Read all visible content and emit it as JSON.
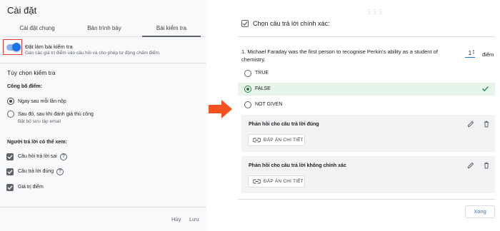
{
  "settings": {
    "title": "Cài đặt",
    "tabs": [
      "Cài đặt chung",
      "Bản trình bày",
      "Bài kiểm tra"
    ],
    "active_tab": "Bài kiểm tra",
    "quiz_toggle": {
      "label": "Đặt làm bài kiểm tra",
      "description": "Gán các giá trị điểm vào câu hỏi và cho phép tự động chấm điểm.",
      "on": true
    },
    "quiz_options_title": "Tùy chọn kiểm tra",
    "release_grade": {
      "title": "Công bố điểm:",
      "options": [
        {
          "label": "Ngay sau mỗi lần nộp",
          "checked": true
        },
        {
          "label": "Sau đó, sau khi đánh giá thủ công",
          "sub": "Bật bộ sưu tập email",
          "checked": false
        }
      ]
    },
    "respondent_can_see": {
      "title": "Người trả lời có thể xem:",
      "items": [
        {
          "label": "Câu hỏi trả lời sai",
          "checked": true
        },
        {
          "label": "Câu trả lời đúng",
          "checked": true
        },
        {
          "label": "Giá trị điểm",
          "checked": true
        }
      ]
    },
    "cancel_label": "Hủy",
    "save_label": "Lưu"
  },
  "answer_key": {
    "header": "Chọn câu trả lời chính xác:",
    "question": "1. Michael Faraday was the first person to recognise Perkin's ability as a student of chemistry.",
    "points_value": "1",
    "points_label": "điểm",
    "answers": [
      {
        "label": "TRUE",
        "correct": false
      },
      {
        "label": "FALSE",
        "correct": true
      },
      {
        "label": "NOT GIVEN",
        "correct": false
      }
    ],
    "feedback_correct_title": "Phản hồi cho câu trả lời đúng",
    "feedback_incorrect_title": "Phản hồi cho câu trả lời không chính xác",
    "feedback_button_label": "ĐÁP ÁN CHI TIẾT",
    "done_label": "Xong"
  },
  "colors": {
    "accent": "#1a73e8",
    "correct_bg": "#e6f4ea",
    "correct": "#188038",
    "arrow": "#f4511e",
    "highlight_border": "#e53935"
  }
}
